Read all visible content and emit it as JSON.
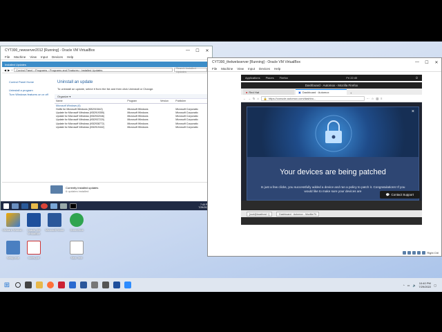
{
  "left_vm": {
    "title": "CYT300_newserver2012 [Running] - Oracle VM VirtualBox",
    "menu": [
      "File",
      "Machine",
      "View",
      "Input",
      "Devices",
      "Help"
    ],
    "explorer_title": "Installed Updates",
    "breadcrumb": [
      "Control Panel",
      "Programs",
      "Programs and Features",
      "Installed Updates"
    ],
    "search_placeholder": "Search Installed Updates",
    "nav": [
      "Control Panel Home",
      "Uninstall a program",
      "Turn Windows features on or off"
    ],
    "heading": "Uninstall an update",
    "description": "To uninstall an update, select it from the list and then click Uninstall or Change.",
    "organize_label": "Organize ▾",
    "columns": [
      "Name",
      "Program",
      "Version",
      "Publisher"
    ],
    "group": "Microsoft Windows (6)",
    "rows": [
      [
        "Hotfix for Microsoft Windows (KB2919442)",
        "Microsoft Windows",
        "",
        "Microsoft Corporatio"
      ],
      [
        "Update for Microsoft Windows (KB2919355)",
        "Microsoft Windows",
        "",
        "Microsoft Corporatio"
      ],
      [
        "Update for Microsoft Windows (KB2932046)",
        "Microsoft Windows",
        "",
        "Microsoft Corporatio"
      ],
      [
        "Update for Microsoft Windows (KB2937220)",
        "Microsoft Windows",
        "",
        "Microsoft Corporatio"
      ],
      [
        "Update for Microsoft Windows (KB2938772)",
        "Microsoft Windows",
        "",
        "Microsoft Corporatio"
      ],
      [
        "Update for Microsoft Windows (KB2919442)",
        "Microsoft Windows",
        "",
        "Microsoft Corporatio"
      ]
    ],
    "status_title": "Currently installed updates",
    "status_sub": "6 updates installed",
    "guest_time": "7:40 PM",
    "guest_date": "7/29/2022"
  },
  "right_vm": {
    "title": "CYT300_thelwelsserver [Running] - Oracle VM VirtualBox",
    "menu": [
      "File",
      "Machine",
      "View",
      "Input",
      "Devices",
      "Help"
    ],
    "gnome": {
      "applications": "Applications",
      "places": "Places",
      "firefox": "Firefox",
      "clock": "Fri 22:40"
    },
    "ff_title": "Dashboard · Automox - Mozilla Firefox",
    "tabs": [
      "Red Hat",
      "Dashboard · Automox"
    ],
    "url": "https://console.automox.com/dashbo...",
    "modal_heading": "Your devices are being patched",
    "modal_text": "In just a few clicks, you successfully added a device and ran a policy to patch it. Congratulations! If you would like to make sure your devices are",
    "close": "×",
    "support": "Contact Support",
    "taskbar_items": [
      "[root@localhost ~]",
      "Dashboard · Automox - Mozilla Fir"
    ],
    "host_key": "Right Ctrl"
  },
  "desktop_icons": [
    "VMware Workst...",
    "Oracle VM VirtualBox",
    "Microsoft Word",
    "GreenShot",
    "Setup.exe",
    "notes.pdf",
    "New Text"
  ],
  "host_taskbar": {
    "time": "10:40 PM",
    "date": "7/29/2022"
  }
}
